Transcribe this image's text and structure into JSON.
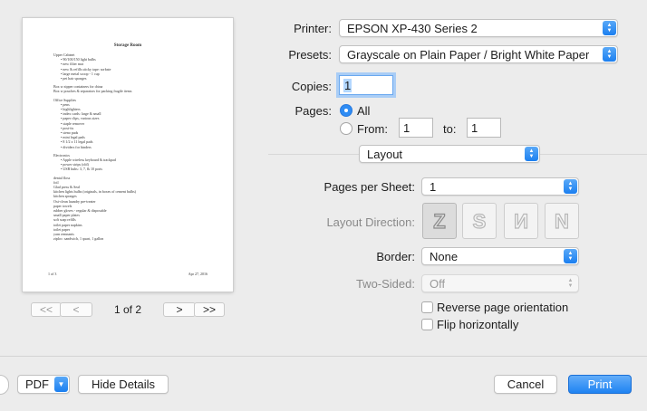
{
  "preview": {
    "title": "Storage Room",
    "sections": [
      {
        "heading": "Upper Cabinet",
        "items": [
          "90/100/150 light bulbs",
          "new filter mat",
          "new & refills sticky tape: sorbate",
          "large metal scoop - 1 cup",
          "pet hair sponges"
        ]
      },
      {
        "lines": [
          "Box w zipper containers for china",
          "Box w pouches & separators for packing fragile items"
        ]
      },
      {
        "heading": "Office Supplies",
        "items": [
          "pens",
          "highlighters",
          "index cards: large & small",
          "paper clips, various sizes",
          "staple remover",
          "post-its",
          "steno pads",
          "mini legal pads",
          "8 1/2 x 11 legal pads",
          "dividers for binders"
        ]
      },
      {
        "heading": "Electronics",
        "items": [
          "Apple wireless keyboard & trackpad",
          "power strips (old)",
          "USB hubs: 3, 7, & 10 ports"
        ]
      },
      {
        "lines": [
          "dental floss",
          "foil",
          "Glad press & Seal",
          "kitchen lights bulbs (originals, in boxes of cement bulbs)",
          "kitchen sponges",
          "Oxi-clean laundry pre-treater",
          "paper towels",
          "rubber gloves - regular & disposable",
          "small paper plates",
          "soft soap refills",
          "toilet paper napkins",
          "toilet paper",
          "yarn remnants",
          "ziploc: sandwich, 1 quart, 1 gallon"
        ]
      }
    ],
    "footer_left": "1 of 3",
    "footer_right": "Apr 27, 2016"
  },
  "nav": {
    "first": "<<",
    "prev": "<",
    "page_indicator": "1 of 2",
    "next": ">",
    "last": ">>"
  },
  "printer": {
    "label": "Printer:",
    "value": "EPSON XP-430 Series 2"
  },
  "presets": {
    "label": "Presets:",
    "value": "Grayscale on Plain Paper / Bright White Paper"
  },
  "copies": {
    "label": "Copies:",
    "value": "1"
  },
  "pages": {
    "label": "Pages:",
    "all_label": "All",
    "from_label": "From:",
    "from_value": "1",
    "to_label": "to:",
    "to_value": "1",
    "selected": "All"
  },
  "section_popup": {
    "value": "Layout"
  },
  "layout": {
    "pages_per_sheet": {
      "label": "Pages per Sheet:",
      "value": "1"
    },
    "layout_direction": {
      "label": "Layout Direction:",
      "icons": [
        "z-direction-icon",
        "s-direction-icon",
        "reverse-n-direction-icon",
        "n-direction-icon"
      ]
    },
    "border": {
      "label": "Border:",
      "value": "None"
    },
    "two_sided": {
      "label": "Two-Sided:",
      "value": "Off"
    },
    "reverse_label": "Reverse page orientation",
    "flip_label": "Flip horizontally"
  },
  "footer": {
    "pdf": "PDF",
    "hide_details": "Hide Details",
    "cancel": "Cancel",
    "print": "Print"
  },
  "colors": {
    "accent": "#1f83f2",
    "background": "#ececec"
  }
}
